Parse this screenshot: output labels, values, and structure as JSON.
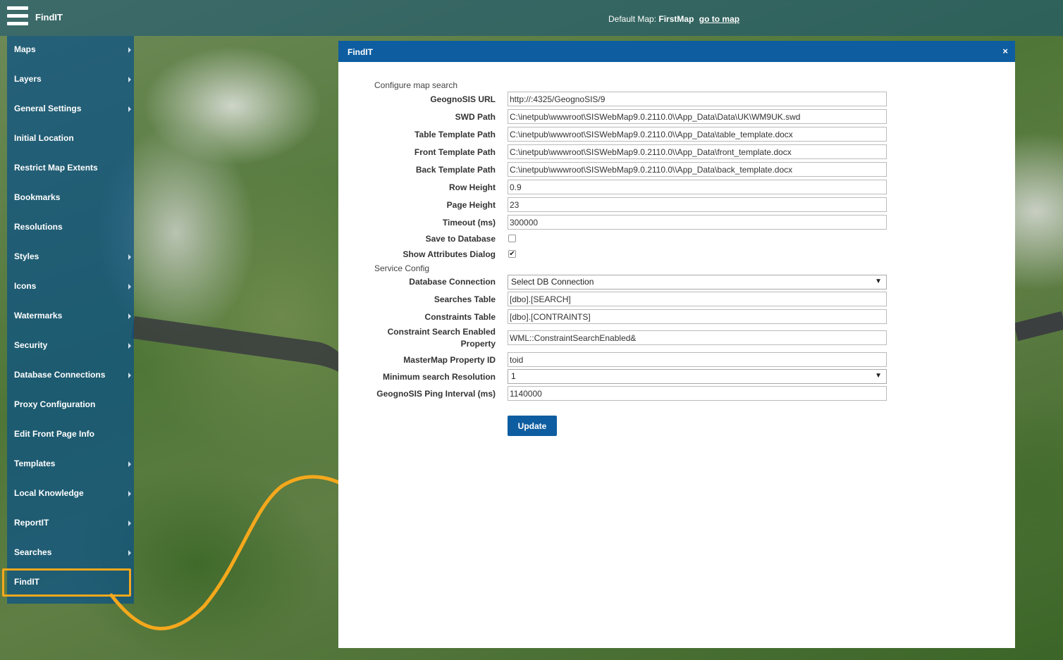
{
  "header": {
    "brand": "FindIT",
    "default_map_label": "Default Map:",
    "default_map_name": "FirstMap",
    "go_to_map": "go to map"
  },
  "sidebar": {
    "items": [
      {
        "label": "Maps",
        "has_submenu": true
      },
      {
        "label": "Layers",
        "has_submenu": true
      },
      {
        "label": "General Settings",
        "has_submenu": true
      },
      {
        "label": "Initial Location",
        "has_submenu": false
      },
      {
        "label": "Restrict Map Extents",
        "has_submenu": false
      },
      {
        "label": "Bookmarks",
        "has_submenu": false
      },
      {
        "label": "Resolutions",
        "has_submenu": false
      },
      {
        "label": "Styles",
        "has_submenu": true
      },
      {
        "label": "Icons",
        "has_submenu": true
      },
      {
        "label": "Watermarks",
        "has_submenu": true
      },
      {
        "label": "Security",
        "has_submenu": true
      },
      {
        "label": "Database Connections",
        "has_submenu": true
      },
      {
        "label": "Proxy Configuration",
        "has_submenu": false
      },
      {
        "label": "Edit Front Page Info",
        "has_submenu": false
      },
      {
        "label": "Templates",
        "has_submenu": true
      },
      {
        "label": "Local Knowledge",
        "has_submenu": true
      },
      {
        "label": "ReportIT",
        "has_submenu": true
      },
      {
        "label": "Searches",
        "has_submenu": true
      },
      {
        "label": "FindIT",
        "has_submenu": false
      }
    ],
    "highlight_color": "#f5a81c"
  },
  "modal": {
    "title": "FindIT",
    "close": "×",
    "section_map_search": "Configure map search",
    "section_service": "Service Config",
    "fields": {
      "geognosis_url": {
        "label": "GeognoSIS URL",
        "value": "http://:4325/GeognoSIS/9"
      },
      "swd_path": {
        "label": "SWD Path",
        "value": "C:\\inetpub\\wwwroot\\SISWebMap9.0.2110.0\\\\App_Data\\Data\\UK\\WM9UK.swd"
      },
      "table_template_path": {
        "label": "Table Template Path",
        "value": "C:\\inetpub\\wwwroot\\SISWebMap9.0.2110.0\\\\App_Data\\table_template.docx"
      },
      "front_template_path": {
        "label": "Front Template Path",
        "value": "C:\\inetpub\\wwwroot\\SISWebMap9.0.2110.0\\\\App_Data\\front_template.docx"
      },
      "back_template_path": {
        "label": "Back Template Path",
        "value": "C:\\inetpub\\wwwroot\\SISWebMap9.0.2110.0\\\\App_Data\\back_template.docx"
      },
      "row_height": {
        "label": "Row Height",
        "value": "0.9"
      },
      "page_height": {
        "label": "Page Height",
        "value": "23"
      },
      "timeout": {
        "label": "Timeout (ms)",
        "value": "300000"
      },
      "save_to_database": {
        "label": "Save to Database",
        "checked": false
      },
      "show_attributes_dialog": {
        "label": "Show Attributes Dialog",
        "checked": true
      },
      "database_connection": {
        "label": "Database Connection",
        "value": "Select DB Connection"
      },
      "searches_table": {
        "label": "Searches Table",
        "value": "[dbo].[SEARCH]"
      },
      "constraints_table": {
        "label": "Constraints Table",
        "value": "[dbo].[CONTRAINTS]"
      },
      "constraint_search_enabled": {
        "label": "Constraint Search Enabled Property",
        "value": "WML::ConstraintSearchEnabled&"
      },
      "mastermap_property_id": {
        "label": "MasterMap Property ID",
        "value": "toid"
      },
      "minimum_search_resolution": {
        "label": "Minimum search Resolution",
        "value": "1"
      },
      "ping_interval": {
        "label": "GeognoSIS Ping Interval (ms)",
        "value": "1140000"
      }
    },
    "update_button": "Update",
    "accent_color": "#0e5da0"
  }
}
